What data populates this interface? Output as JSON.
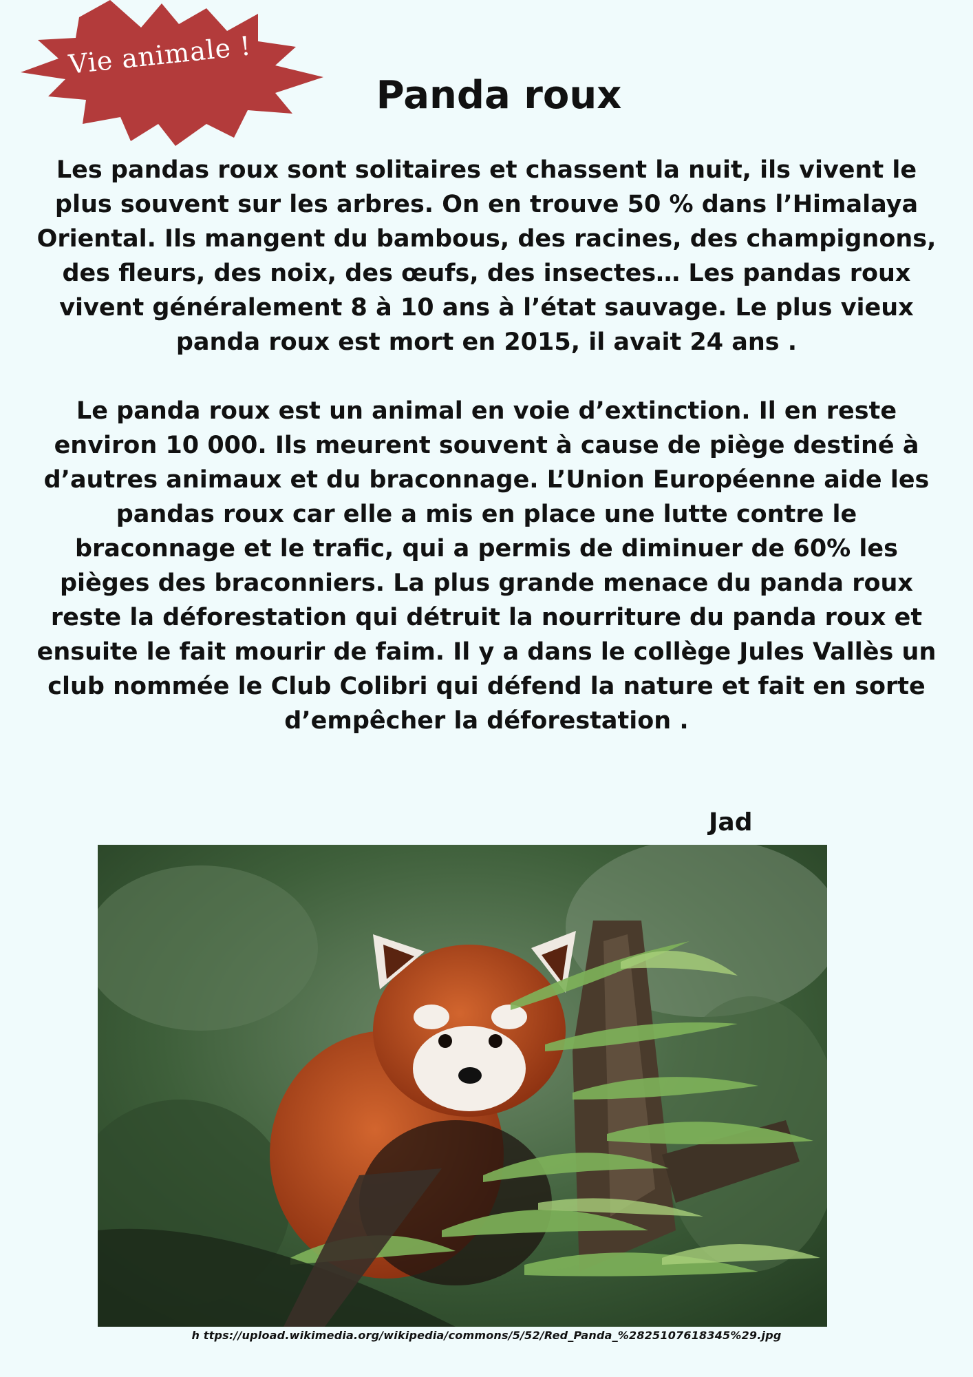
{
  "badge": {
    "label": "Vie animale !",
    "color": "#b33b3b"
  },
  "title": "Panda roux",
  "article": {
    "paragraphs": [
      "Les pandas roux sont solitaires et chassent la nuit, ils vivent le plus souvent sur les arbres. On en trouve 50 % dans l’Himalaya Oriental. Ils mangent du bambous, des racines, des champignons, des fleurs, des noix,  des œufs, des insectes… Les pandas roux vivent généralement 8 à 10 ans à l’état sauvage. Le plus vieux panda roux est mort en 2015, il avait 24 ans .",
      "Le panda roux est un animal en voie d’extinction. Il en reste environ 10 000. Ils meurent souvent à cause de piège destiné à d’autres animaux et du braconnage. L’Union Européenne aide les pandas roux car elle a mis en place une lutte contre le braconnage et le trafic, qui a permis de diminuer de 60% les pièges des braconniers. La plus grande menace du panda roux reste la déforestation qui détruit la nourriture du panda roux et ensuite le fait mourir de faim. Il y a dans le collège Jules Vallès un club nommée le Club Colibri qui défend la nature et fait en sorte d’empêcher la déforestation ."
    ]
  },
  "author": "Jad",
  "photo": {
    "subject": "red-panda-in-bamboo"
  },
  "credit": "h ttps://upload.wikimedia.org/wikipedia/commons/5/52/Red_Panda_%2825107618345%29.jpg"
}
